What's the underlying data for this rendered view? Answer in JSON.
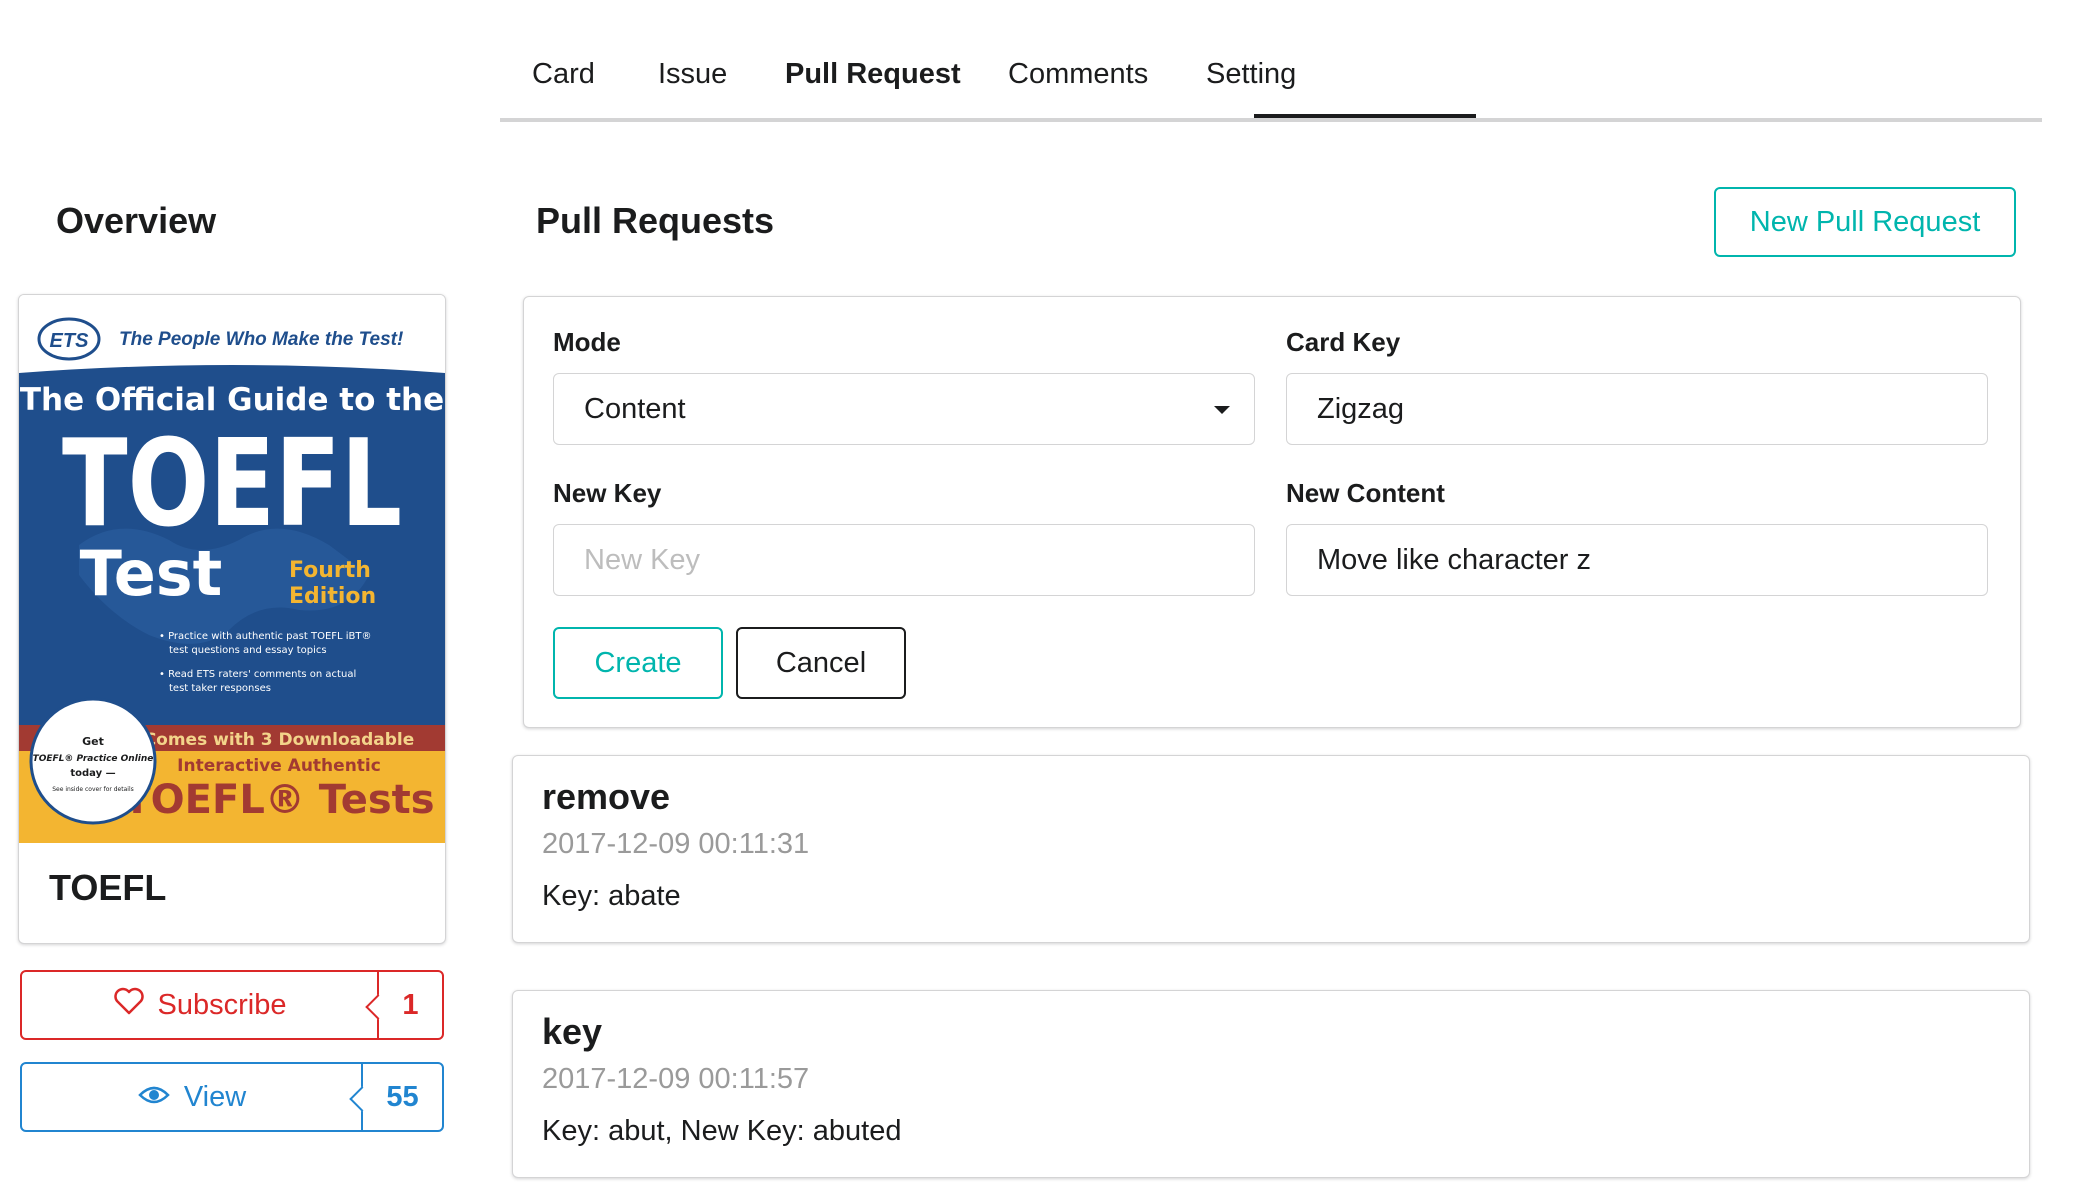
{
  "tabs": [
    {
      "label": "Card",
      "active": false
    },
    {
      "label": "Issue",
      "active": false
    },
    {
      "label": "Pull Request",
      "active": true
    },
    {
      "label": "Comments",
      "active": false
    },
    {
      "label": "Setting",
      "active": false
    }
  ],
  "sidebar": {
    "title": "Overview",
    "card": {
      "name": "TOEFL",
      "cover": {
        "publisher": "ETS",
        "tagline": "The People Who Make the Test!",
        "line1": "The Official Guide to the",
        "big_title": "TOEFL",
        "subtitle": "Test",
        "edition_line1": "Fourth",
        "edition_line2": "Edition",
        "bullet1_a": "• Practice with authentic past TOEFL iBT®",
        "bullet1_b": "test questions and essay topics",
        "bullet2_a": "• Read ETS raters' comments on actual",
        "bullet2_b": "test taker responses",
        "badge_line1": "Get",
        "badge_line2": "TOEFL® Practice Online",
        "badge_line3": "today —",
        "badge_line4": "See inside cover for details",
        "banner_line1": "Comes with 3 Downloadable",
        "banner_line2": "Interactive Authentic",
        "banner_line3": "TOEFL® Tests"
      }
    },
    "subscribe": {
      "label": "Subscribe",
      "count": "1"
    },
    "view": {
      "label": "View",
      "count": "55"
    }
  },
  "main": {
    "title": "Pull Requests",
    "new_button": "New Pull Request",
    "form": {
      "mode_label": "Mode",
      "mode_value": "Content",
      "card_key_label": "Card Key",
      "card_key_value": "Zigzag",
      "new_key_label": "New Key",
      "new_key_placeholder": "New Key",
      "new_content_label": "New Content",
      "new_content_value": "Move like character z",
      "create_label": "Create",
      "cancel_label": "Cancel"
    },
    "pull_requests": [
      {
        "title": "remove",
        "date": "2017-12-09 00:11:31",
        "description": "Key: abate"
      },
      {
        "title": "key",
        "date": "2017-12-09 00:11:57",
        "description": "Key: abut, New Key: abuted"
      }
    ]
  },
  "colors": {
    "teal": "#00b5ad",
    "red": "#db2828",
    "blue": "#2185d0",
    "cover_blue": "#1f4e8c",
    "cover_red": "#a23a32",
    "cover_yellow": "#f3b531"
  }
}
